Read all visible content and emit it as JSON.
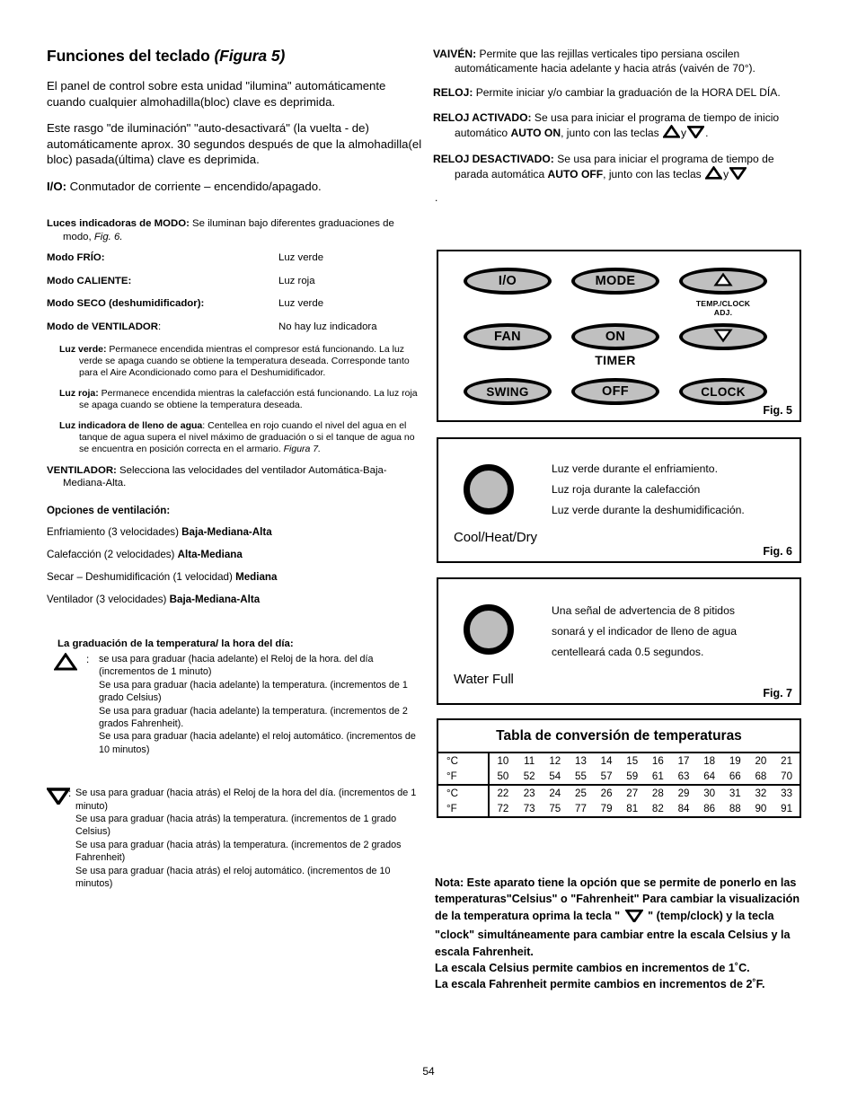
{
  "page": {
    "number": "54"
  },
  "left": {
    "title_main": "Funciones del teclado",
    "title_fig": "(Figura 5)",
    "para1": "El panel de control sobre esta unidad \"ilumina\" automáticamente cuando cualquier almohadilla(bloc) clave es deprimida.",
    "para2": " Este rasgo \"de iluminación\" \"auto-desactivará\" (la vuelta - de) automáticamente aprox. 30 segundos después de que la almohadilla(el bloc) pasada(última) clave es deprimida.",
    "io_label": "I/O:",
    "io_text": " Conmutador de corriente – encendido/apagado.",
    "mode_lights": {
      "label": "Luces indicadoras de MODO:",
      "text": "  Se iluminan bajo diferentes graduaciones de modo, ",
      "figref": "Fig. 6."
    },
    "modes": [
      {
        "label": "Modo FRÍO:",
        "value": "Luz verde"
      },
      {
        "label": "Modo CALIENTE:",
        "value": "Luz roja"
      },
      {
        "label": "Modo SECO (deshumidificador):",
        "value": "Luz verde"
      },
      {
        "label": "Modo de VENTILADOR",
        "suffix": ":",
        "value": "No hay luz indicadora"
      }
    ],
    "subdefs": [
      {
        "label": "Luz verde:",
        "text": "  Permanece encendida mientras el compresor está funcionando.  La luz verde se apaga cuando se obtiene la temperatura deseada.  Corresponde tanto para el Aire Acondicionado como para el Deshumidificador."
      },
      {
        "label": "Luz roja:",
        "text": "  Permanece encendida mientras la calefacción está funcionando.  La luz roja se apaga cuando se obtiene la temperatura deseada."
      },
      {
        "label": "Luz indicadora de lleno de agua",
        "suffix": ":",
        "text": "  Centellea en rojo cuando el nivel del agua en el tanque de agua supera el nivel máximo de graduación o si el tanque de agua no se encuentra en posición correcta en el armario. ",
        "figref": "Figura 7."
      }
    ],
    "fan_def": {
      "label": "VENTILADOR:",
      "text": " Selecciona las velocidades del ventilador Automática-Baja-Mediana-Alta."
    },
    "options_head": "Opciones de ventilación:",
    "options": [
      {
        "text": "Enfriamiento (3 velocidades) ",
        "bold": "Baja-Mediana-Alta"
      },
      {
        "text": "Calefacción (2 velocidades) ",
        "bold": "Alta-Mediana"
      },
      {
        "text": "Secar – Deshumidificación (1 velocidad)  ",
        "bold": "Mediana"
      },
      {
        "text": "Ventilador (3 velocidades) ",
        "bold": "Baja-Mediana-Alta"
      }
    ],
    "grad_head": "La graduación de la temperatura/ la hora del día:",
    "up_arrow": {
      "colon": ":",
      "lines": [
        "se usa para graduar (hacia adelante) el Reloj de la hora. del día (incrementos de 1 minuto)",
        "Se usa para graduar (hacia adelante) la temperatura. (incrementos de 1 grado Celsius)",
        "Se usa para graduar (hacia adelante) la temperatura. (incrementos de 2 grados Fahrenheit).",
        "Se usa para graduar (hacia adelante) el reloj automático. (incrementos de 10 minutos)"
      ]
    },
    "down_arrow": {
      "colon": ":",
      "lines": [
        "Se usa para graduar (hacia atrás) el Reloj de la hora del día. (incrementos de 1 minuto)",
        "Se usa para graduar (hacia atrás) la temperatura. (incrementos de 1 grado Celsius)",
        "Se usa para graduar (hacia atrás) la temperatura. (incrementos de 2 grados Fahrenheit)",
        "Se usa para graduar (hacia atrás) el reloj automático. (incrementos de 10 minutos)"
      ]
    }
  },
  "right": {
    "swing": {
      "label": "VAIVÉN:",
      "text": "  Permite que las rejillas verticales tipo persiana oscilen automáticamente hacia adelante y hacia atrás (vaivén de 70°)."
    },
    "clock": {
      "label": "RELOJ:",
      "text": "  Permite iniciar y/o cambiar la graduación de la HORA DEL DÍA."
    },
    "clock_on": {
      "label": "RELOJ ACTIVADO:",
      "text1": "  Se usa para iniciar el programa de tiempo de inicio automático ",
      "bold": "AUTO ON",
      "text2": ", junto con las teclas ",
      "conj": "y",
      "tail": "."
    },
    "clock_off": {
      "label": "RELOJ DESACTIVADO:",
      "text1": "  Se usa para iniciar el programa de tiempo de parada automática ",
      "bold": "AUTO OFF",
      "text2": ", junto con las teclas ",
      "conj": "y",
      "tail": ""
    },
    "stray_dot": ".",
    "fig5": {
      "buttons": [
        {
          "name": "io",
          "label": "I/O"
        },
        {
          "name": "mode",
          "label": "MODE"
        },
        {
          "name": "temp-up",
          "label": ""
        },
        {
          "name": "fan",
          "label": "FAN"
        },
        {
          "name": "timer-on",
          "label": "ON"
        },
        {
          "name": "temp-down",
          "label": ""
        },
        {
          "name": "swing",
          "label": "SWING"
        },
        {
          "name": "timer-off",
          "label": "OFF"
        },
        {
          "name": "clock",
          "label": "CLOCK"
        }
      ],
      "temp_clock_label_line1": "TEMP./CLOCK",
      "temp_clock_label_line2": "ADJ.",
      "timer_label": "TIMER",
      "caption": "Fig. 5"
    },
    "fig6": {
      "lamp_caption": "Cool/Heat/Dry",
      "lines": [
        "Luz verde durante el enfriamiento.",
        "Luz roja durante la calefacción",
        "Luz verde durante la deshumidificación."
      ],
      "caption": "Fig. 6"
    },
    "fig7": {
      "lamp_caption": "Water Full",
      "lines": [
        "Una señal de advertencia de 8 pitidos",
        "sonará y el indicador de lleno de agua",
        "centelleará cada 0.5 segundos."
      ],
      "caption": "Fig. 7"
    },
    "conversion_table": {
      "title": "Tabla de conversión de temperaturas",
      "unit_c": "°C",
      "unit_f": "°F",
      "block1_c": [
        "10",
        "11",
        "12",
        "13",
        "14",
        "15",
        "16",
        "17",
        "18",
        "19",
        "20",
        "21"
      ],
      "block1_f": [
        "50",
        "52",
        "54",
        "55",
        "57",
        "59",
        "61",
        "63",
        "64",
        "66",
        "68",
        "70"
      ],
      "block2_c": [
        "22",
        "23",
        "24",
        "25",
        "26",
        "27",
        "28",
        "29",
        "30",
        "31",
        "32",
        "33"
      ],
      "block2_f": [
        "72",
        "73",
        "75",
        "77",
        "79",
        "81",
        "82",
        "84",
        "86",
        "88",
        "90",
        "91"
      ]
    },
    "nota": {
      "part1": "Nota: Este aparato tiene la opción que se permite de ponerlo en las temperaturas\"Celsius\" o \"Fahrenheit\" Para cambiar la visualización de la temperatura oprima la tecla \" ",
      "part2": " \" (temp/clock) y la tecla \"clock\" simultáneamente para cambiar entre la escala Celsius y la escala Fahrenheit.",
      "line_c": "La escala Celsius permite cambios en incrementos de 1˚C.",
      "line_f": "La escala Fahrenheit permite cambios en incrementos de 2˚F."
    }
  },
  "colors": {
    "button_fill": "#c0c0c0",
    "lamp_fill": "#bdbdbd",
    "ink": "#000000",
    "paper": "#ffffff"
  }
}
